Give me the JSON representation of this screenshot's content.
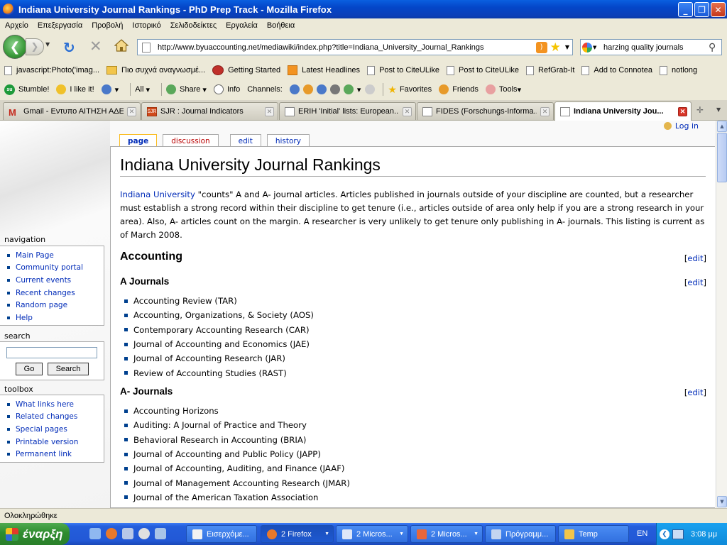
{
  "window": {
    "title": "Indiana University Journal Rankings - PhD Prep Track - Mozilla Firefox"
  },
  "menu": [
    "Αρχείο",
    "Επεξεργασία",
    "Προβολή",
    "Ιστορικό",
    "Σελιδοδείκτες",
    "Εργαλεία",
    "Βοήθεια"
  ],
  "nav": {
    "url": "http://www.byuaccounting.net/mediawiki/index.php?title=Indiana_University_Journal_Rankings",
    "search_query": "harzing quality journals"
  },
  "bookmarks": [
    "javascript:Photo('imag...",
    "Πιο συχνά αναγνωσμέ...",
    "Getting Started",
    "Latest Headlines",
    "Post to CiteULike",
    "Post to CiteULike",
    "RefGrab-It",
    "Add to Connotea",
    "notlong"
  ],
  "stumble": {
    "stumble": "Stumble!",
    "like": "I like it!",
    "all": "All",
    "share": "Share",
    "info": "Info",
    "channels": "Channels:",
    "favorites": "Favorites",
    "friends": "Friends",
    "tools": "Tools"
  },
  "tabs": [
    "Gmail - Εντυπο ΑΙΤΗΣΗ ΑΔΕ...",
    "SJR : Journal Indicators",
    "ERIH 'Initial' lists: European...",
    "FIDES (Forschungs-Informa...",
    "Indiana University Jou..."
  ],
  "wiki": {
    "login": "Log in",
    "page_tabs": [
      "page",
      "discussion",
      "edit",
      "history"
    ],
    "title": "Indiana University Journal Rankings",
    "intro_link": "Indiana University",
    "intro_text": " \"counts\" A and A- journal articles. Articles published in journals outside of your discipline are counted, but a researcher must establish a strong record within their discipline to get tenure (i.e., articles outside of area only help if you are a strong research in your area). Also, A- articles count on the margin. A researcher is very unlikely to get tenure only publishing in A- journals. This listing is current as of March 2008.",
    "edit_label": "edit",
    "section": "Accounting",
    "a_heading": "A Journals",
    "a_journals": [
      "Accounting Review (TAR)",
      "Accounting, Organizations, & Society (AOS)",
      "Contemporary Accounting Research (CAR)",
      "Journal of Accounting and Economics (JAE)",
      "Journal of Accounting Research (JAR)",
      "Review of Accounting Studies (RAST)"
    ],
    "aminus_heading": "A- Journals",
    "aminus_journals": [
      "Accounting Horizons",
      "Auditing: A Journal of Practice and Theory",
      "Behavioral Research in Accounting (BRIA)",
      "Journal of Accounting and Public Policy (JAPP)",
      "Journal of Accounting, Auditing, and Finance (JAAF)",
      "Journal of Management Accounting Research (JMAR)",
      "Journal of the American Taxation Association"
    ]
  },
  "sidebar": {
    "navigation_title": "navigation",
    "navigation": [
      "Main Page",
      "Community portal",
      "Current events",
      "Recent changes",
      "Random page",
      "Help"
    ],
    "search_title": "search",
    "go": "Go",
    "search": "Search",
    "toolbox_title": "toolbox",
    "toolbox": [
      "What links here",
      "Related changes",
      "Special pages",
      "Printable version",
      "Permanent link"
    ]
  },
  "status": "Ολοκληρώθηκε",
  "taskbar": {
    "start": "έναρξη",
    "tasks": [
      "Εισερχόμε...",
      "2 Firefox",
      "2 Micros...",
      "2 Micros...",
      "Πρόγραμμ...",
      "Temp"
    ],
    "lang": "EN",
    "clock": "3:08 μμ"
  }
}
